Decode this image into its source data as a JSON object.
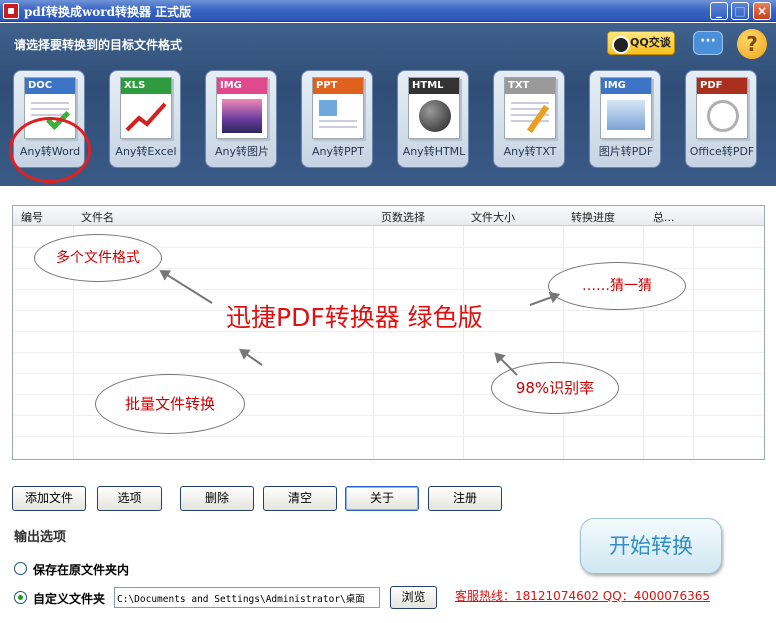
{
  "window": {
    "title": "pdf转换成word转换器 正式版",
    "minimize": "_",
    "maximize": "□",
    "close": "×"
  },
  "header": {
    "prompt": "请选择要转换到的目标文件格式",
    "qq_label": "QQ交谈",
    "chat_glyph": "···",
    "help_glyph": "?"
  },
  "formats": [
    {
      "tag": "DOC",
      "label": "Any转Word",
      "color": "#3d74c6"
    },
    {
      "tag": "XLS",
      "label": "Any转Excel",
      "color": "#2e9b3e"
    },
    {
      "tag": "IMG",
      "label": "Any转图片",
      "color": "#e04a8c"
    },
    {
      "tag": "PPT",
      "label": "Any转PPT",
      "color": "#e0601e"
    },
    {
      "tag": "HTML",
      "label": "Any转HTML",
      "color": "#333333"
    },
    {
      "tag": "TXT",
      "label": "Any转TXT",
      "color": "#9a9a9a"
    },
    {
      "tag": "IMG",
      "label": "图片转PDF",
      "color": "#3d74c6"
    },
    {
      "tag": "PDF",
      "label": "Office转PDF",
      "color": "#a9301e"
    }
  ],
  "file_list": {
    "columns": [
      "编号",
      "文件名",
      "页数选择",
      "文件大小",
      "转换进度",
      "总..."
    ]
  },
  "annotations": {
    "formats": "多个文件格式",
    "center": "迅捷PDF转换器 绿色版",
    "guess": "……猜一猜",
    "batch": "批量文件转换",
    "rate": "98%识别率"
  },
  "buttons": {
    "add": "添加文件",
    "options": "选项",
    "delete": "删除",
    "clear": "清空",
    "about": "关于",
    "register": "注册",
    "start": "开始转换",
    "browse": "浏览"
  },
  "output": {
    "label": "输出选项",
    "original_folder": "保存在原文件夹内",
    "custom_folder": "自定义文件夹",
    "path": "C:\\Documents and Settings\\Administrator\\桌面",
    "selected": "custom"
  },
  "hotline": "客服热线：18121074602 QQ：4000076365",
  "colors": {
    "accent_red": "#e01010",
    "header_bg": "#3a5b86",
    "start_text": "#2f8fc4"
  }
}
